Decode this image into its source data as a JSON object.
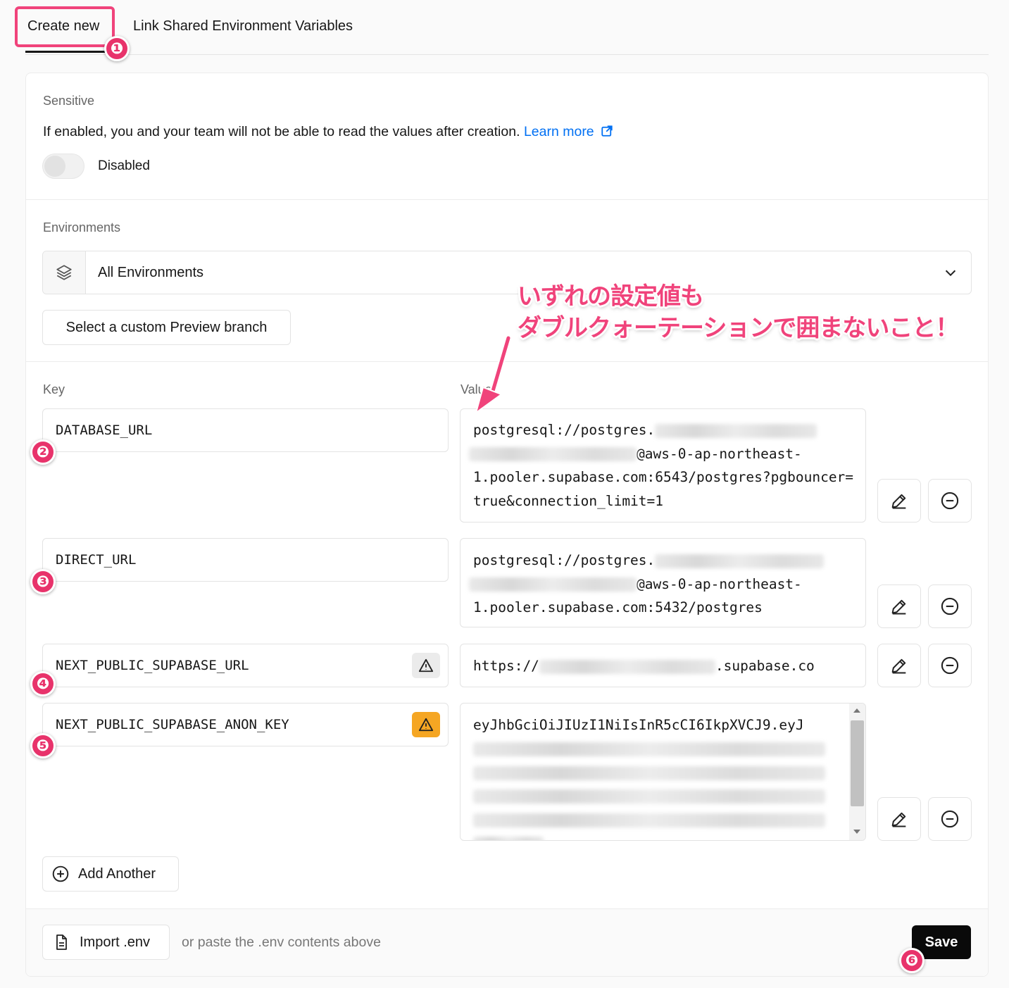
{
  "tabs": [
    {
      "label": "Create new"
    },
    {
      "label": "Link Shared Environment Variables"
    }
  ],
  "sensitive": {
    "heading": "Sensitive",
    "description": "If enabled, you and your team will not be able to read the values after creation.",
    "learn_more": "Learn more",
    "toggle_state": "Disabled"
  },
  "environments": {
    "heading": "Environments",
    "selected": "All Environments",
    "custom_branch_button": "Select a custom Preview branch"
  },
  "columns": {
    "key": "Key",
    "value": "Value"
  },
  "variables": [
    {
      "key": "DATABASE_URL",
      "value_start": "postgresql://postgres.",
      "value_mid": "@aws-0-ap-northeast-",
      "value_end": "1.pooler.supabase.com:6543/postgres?pgbouncer=true&connection_limit=1"
    },
    {
      "key": "DIRECT_URL",
      "value_start": "postgresql://postgres.",
      "value_mid": "@aws-0-ap-northeast-",
      "value_end": "1.pooler.supabase.com:5432/postgres"
    },
    {
      "key": "NEXT_PUBLIC_SUPABASE_URL",
      "value_start": "https://",
      "value_end": ".supabase.co"
    },
    {
      "key": "NEXT_PUBLIC_SUPABASE_ANON_KEY",
      "value_start": "eyJhbGciOiJIUzI1NiIsInR5cCI6IkpXVCJ9.eyJ"
    }
  ],
  "add_another": "Add Another",
  "footer": {
    "import_label": "Import .env",
    "hint": "or paste the .env contents above",
    "save_label": "Save"
  },
  "annotation": {
    "line1": "いずれの設定値も",
    "line2": "ダブルクォーテーションで囲まないこと！"
  },
  "badges": [
    "❶",
    "❷",
    "❸",
    "❹",
    "❺",
    "❻"
  ],
  "colors": {
    "annotation": "#f0437b",
    "warning": "#f5a623",
    "link": "#0070f3"
  },
  "icons": [
    "layers-icon",
    "chevron-down-icon",
    "external-link-icon",
    "warning-icon",
    "pencil-icon",
    "minus-circle-icon",
    "plus-circle-icon",
    "file-icon"
  ]
}
